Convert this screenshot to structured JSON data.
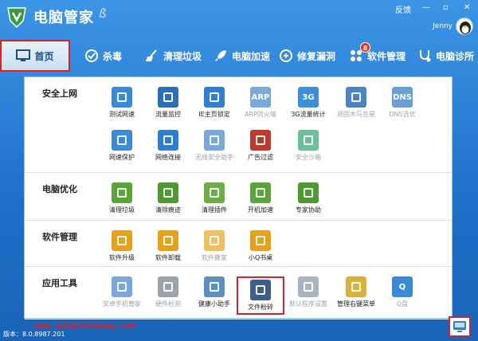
{
  "app": {
    "title": "电脑管家",
    "title_deco": "ß"
  },
  "window_controls": {
    "feedback": "反馈",
    "min": "—",
    "max": "▫",
    "close": "✕"
  },
  "user": {
    "name": "Jenny"
  },
  "nav": [
    {
      "label": "首页",
      "icon": "monitor-icon"
    },
    {
      "label": "杀毒",
      "icon": "shield-scan-icon"
    },
    {
      "label": "清理垃圾",
      "icon": "broom-icon"
    },
    {
      "label": "电脑加速",
      "icon": "rocket-icon"
    },
    {
      "label": "修复漏洞",
      "icon": "wrench-icon"
    },
    {
      "label": "软件管理",
      "icon": "apps-icon",
      "badge": "8"
    },
    {
      "label": "电脑诊所",
      "icon": "stethoscope-icon"
    }
  ],
  "sections": [
    {
      "title": "安全上网",
      "items": [
        {
          "label": "测试网速",
          "icon": "speedometer-icon",
          "color": "#3a8ad6"
        },
        {
          "label": "流量监控",
          "icon": "chart-icon",
          "color": "#2e6eb5"
        },
        {
          "label": "IE主页锁定",
          "icon": "ie-lock-icon",
          "color": "#2f7fd0"
        },
        {
          "label": "ARP防火墙",
          "icon": "arp-icon",
          "text": "ARP",
          "color": "#7aa9d9",
          "dim": true
        },
        {
          "label": "3G流量统计",
          "icon": "3g-icon",
          "text": "3G",
          "color": "#3d8fd9"
        },
        {
          "label": "顽固木马克星",
          "icon": "horse-icon",
          "color": "#4a84c2",
          "dim": true
        },
        {
          "label": "DNS选优",
          "icon": "dns-icon",
          "text": "DNS",
          "color": "#6a9fd6",
          "dim": true
        },
        {
          "label": "网速保护",
          "icon": "chevrons-down-icon",
          "color": "#3a8ad6"
        },
        {
          "label": "网络连接",
          "icon": "globe-icon",
          "color": "#2f7fd0"
        },
        {
          "label": "无线安全助手",
          "icon": "wifi-icon",
          "color": "#7aa9d9",
          "dim": true
        },
        {
          "label": "广告过滤",
          "icon": "ad-block-icon",
          "color": "#c0392b"
        },
        {
          "label": "安全沙箱",
          "icon": "sandbox-icon",
          "color": "#6bbf9c",
          "dim": true
        }
      ]
    },
    {
      "title": "电脑优化",
      "items": [
        {
          "label": "清理垃圾",
          "icon": "clean-icon",
          "color": "#5aa43a"
        },
        {
          "label": "清除痕迹",
          "icon": "eraser-icon",
          "color": "#4d9a32"
        },
        {
          "label": "清理插件",
          "icon": "puzzle-icon",
          "color": "#6cae45"
        },
        {
          "label": "开机加速",
          "icon": "plane-icon",
          "color": "#5aa43a"
        },
        {
          "label": "专家协助",
          "icon": "expert-icon",
          "color": "#4d9a32"
        }
      ]
    },
    {
      "title": "软件管理",
      "items": [
        {
          "label": "软件升级",
          "icon": "upgrade-icon",
          "color": "#e8a21a"
        },
        {
          "label": "软件卸载",
          "icon": "trash-icon",
          "color": "#e8a21a"
        },
        {
          "label": "软件搬家",
          "icon": "truck-icon",
          "color": "#f0c060",
          "dim": true
        },
        {
          "label": "小Q书桌",
          "icon": "flower-icon",
          "color": "#e8a21a"
        }
      ]
    },
    {
      "title": "应用工具",
      "items": [
        {
          "label": "安卓手机管家",
          "icon": "phone-manager-icon",
          "color": "#7aa9d9",
          "dim": true
        },
        {
          "label": "硬件检测",
          "icon": "hardware-icon",
          "color": "#9aa4ad",
          "dim": true
        },
        {
          "label": "健康小助手",
          "icon": "alarm-clock-icon",
          "color": "#5f8fbf"
        },
        {
          "label": "文件粉碎",
          "icon": "shredder-icon",
          "color": "#3d5f8a",
          "highlight": true
        },
        {
          "label": "默认程序设置",
          "icon": "gear-icon",
          "color": "#a8b4c0",
          "dim": true
        },
        {
          "label": "管理右键菜单",
          "icon": "mouse-icon",
          "color": "#d9b23a"
        },
        {
          "label": "Q盘",
          "icon": "q-disk-icon",
          "text": "Q",
          "color": "#3a8ad6",
          "dim": true
        }
      ]
    }
  ],
  "status": {
    "watermark": "www.qinpinchang.com",
    "version": "版本：8.0.8987.201"
  }
}
